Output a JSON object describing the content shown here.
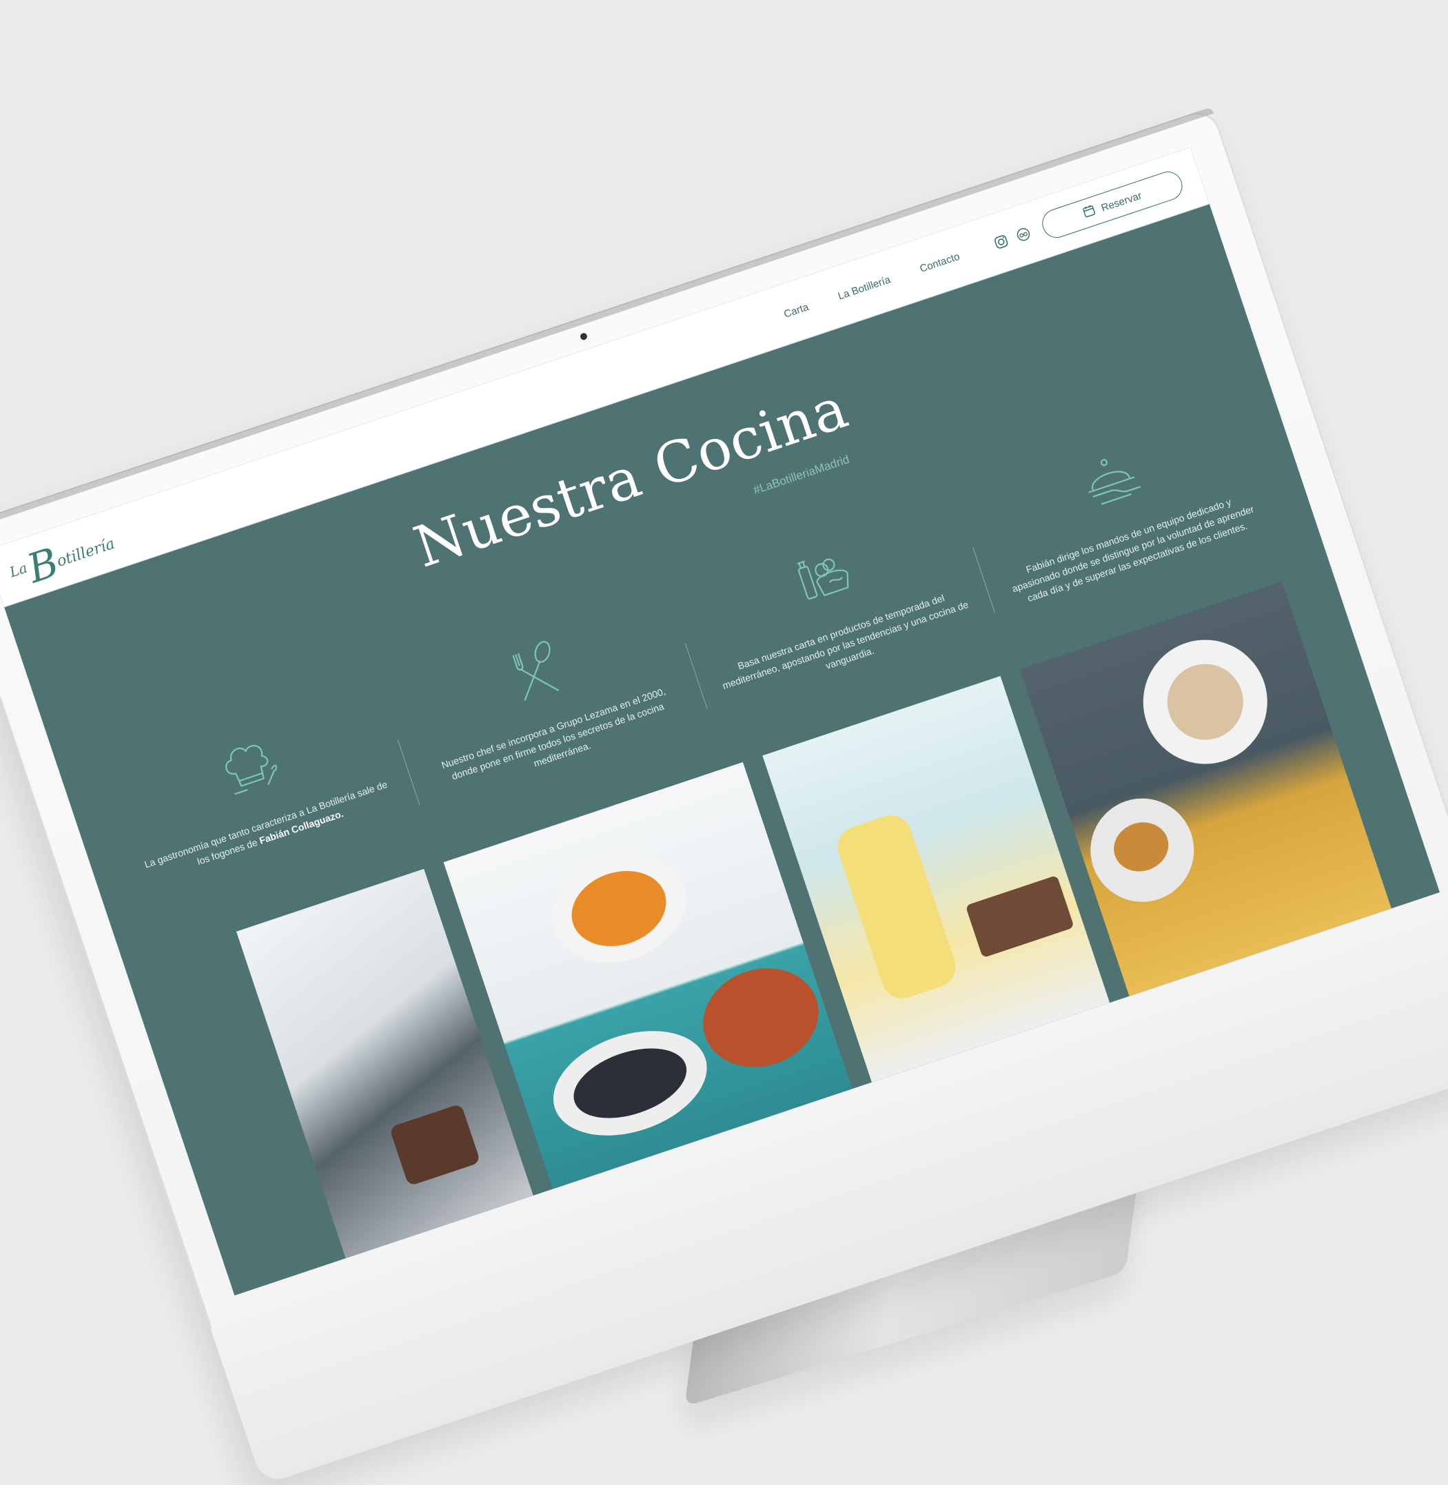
{
  "brand": {
    "prefix": "La",
    "initial": "B",
    "rest": "otillería",
    "accent": "#3c7d76",
    "page_bg": "#4f7272"
  },
  "nav": {
    "links": [
      "Carta",
      "La Botillería",
      "Contacto"
    ],
    "social": [
      "instagram-icon",
      "tripadvisor-icon"
    ],
    "reserve_label": "Reservar",
    "reserve_icon": "calendar-icon"
  },
  "hero": {
    "title": "Nuestra Cocina",
    "hashtag": "#LaBotilleriaMadrid"
  },
  "features": [
    {
      "icon": "chef-hat-icon",
      "text": "La gastronomía que tanto caracteriza a La Botillería sale de los fogones de",
      "highlight": "Fabián Collaguazo."
    },
    {
      "icon": "fork-spoon-icon",
      "text": "Nuestro chef se incorpora a Grupo Lezama en el 2000, donde pone en firme todos los secretos de la cocina mediterránea.",
      "highlight": ""
    },
    {
      "icon": "ingredients-icon",
      "text": "Basa nuestra carta en productos de temporada del mediterráneo, apostando por las tendencias y una cocina de vanguardia.",
      "highlight": ""
    },
    {
      "icon": "serving-cloche-icon",
      "text": "Fabián dirige los mandos de un equipo dedicado y apasionado donde se distingue por la voluntad de aprender cada día y de superar las expectativas de los clientes.",
      "highlight": ""
    }
  ],
  "gallery": [
    {
      "name": "chef-pouring-chocolate-photo"
    },
    {
      "name": "salmorejo-and-mussels-photo"
    },
    {
      "name": "drinks-and-tiramisu-photo"
    },
    {
      "name": "coffee-and-paella-photo"
    }
  ]
}
